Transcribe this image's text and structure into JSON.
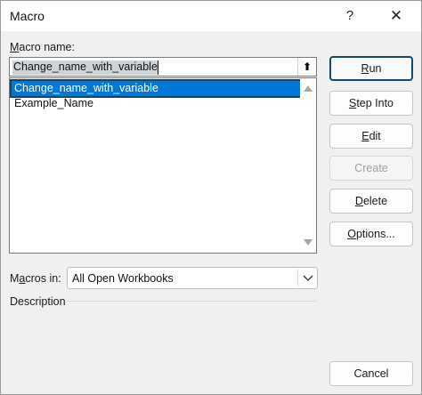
{
  "window": {
    "title": "Macro",
    "help_glyph": "?",
    "close_glyph": "✕"
  },
  "macro_name": {
    "label_pre": "",
    "label_key": "M",
    "label_post": "acro name:",
    "value": "Change_name_with_variable",
    "up_glyph": "⬆"
  },
  "macro_list": {
    "items": [
      "Change_name_with_variable",
      "Example_Name"
    ],
    "selected_index": 0
  },
  "buttons": {
    "run": {
      "pre": "",
      "key": "R",
      "post": "un"
    },
    "step_into": {
      "pre": "",
      "key": "S",
      "post": "tep Into"
    },
    "edit": {
      "pre": "",
      "key": "E",
      "post": "dit"
    },
    "create": {
      "pre": "Create",
      "key": "",
      "post": ""
    },
    "delete": {
      "pre": "",
      "key": "D",
      "post": "elete"
    },
    "options": {
      "pre": "",
      "key": "O",
      "post": "ptions..."
    },
    "cancel": {
      "pre": "Cancel",
      "key": "",
      "post": ""
    }
  },
  "macros_in": {
    "label_pre": "M",
    "label_key": "a",
    "label_post": "cros in:",
    "selected": "All Open Workbooks"
  },
  "description": {
    "label": "Description"
  },
  "colors": {
    "selection": "#0078d7",
    "default_button_border": "#0f4c6e"
  }
}
